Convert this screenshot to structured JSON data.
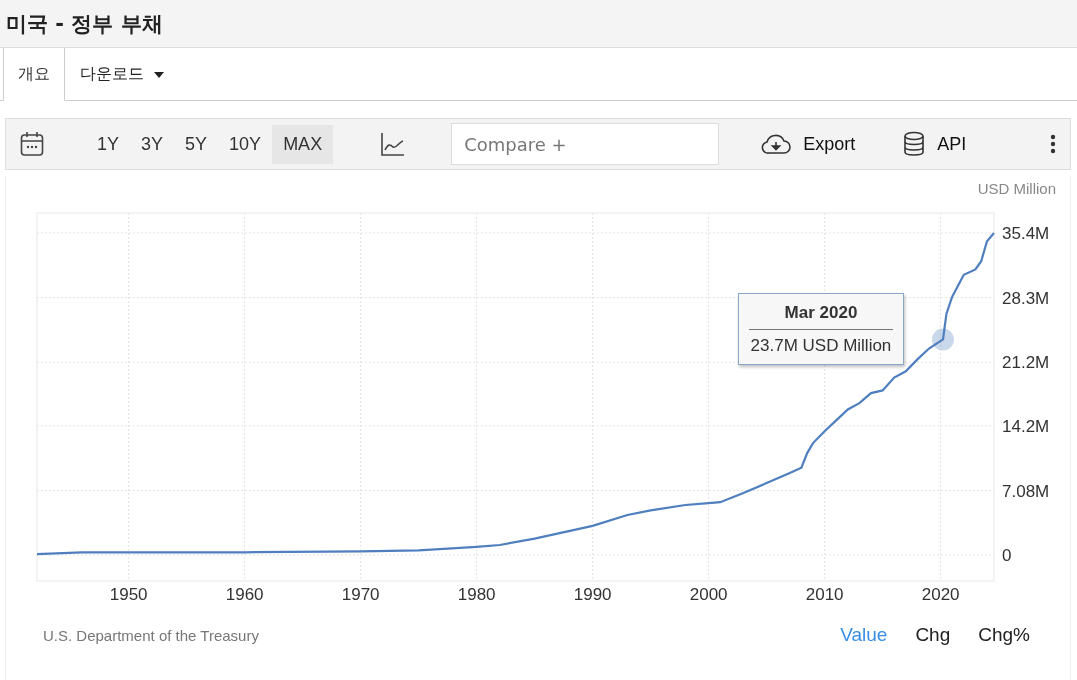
{
  "page": {
    "title": "미국 - 정부 부채"
  },
  "tabs": [
    {
      "label": "개요",
      "selected": true,
      "dropdown": false
    },
    {
      "label": "다운로드",
      "selected": false,
      "dropdown": true
    }
  ],
  "toolbar": {
    "ranges": [
      {
        "label": "1Y",
        "selected": false
      },
      {
        "label": "3Y",
        "selected": false
      },
      {
        "label": "5Y",
        "selected": false
      },
      {
        "label": "10Y",
        "selected": false
      },
      {
        "label": "MAX",
        "selected": true
      }
    ],
    "compare": {
      "placeholder": "Compare +"
    },
    "export": "Export",
    "api": "API"
  },
  "chart": {
    "unit": "USD Million",
    "chart_data": {
      "type": "line",
      "x": [
        1942.1,
        1946,
        1950,
        1960,
        1970,
        1975,
        1980,
        1982,
        1985,
        1990,
        1993,
        1995,
        1998,
        2000,
        2001,
        2003,
        2005,
        2007,
        2008,
        2008.5,
        2009,
        2010,
        2011,
        2012,
        2013,
        2014,
        2015,
        2016,
        2017,
        2018,
        2019,
        2020.2,
        2020.5,
        2021,
        2022,
        2023,
        2023.5,
        2024,
        2024.6
      ],
      "series": [
        {
          "color": "#4f7fbf",
          "values": [
            0.1,
            0.3,
            0.3,
            0.3,
            0.4,
            0.5,
            0.9,
            1.1,
            1.8,
            3.2,
            4.4,
            4.9,
            5.5,
            5.7,
            5.8,
            6.8,
            7.9,
            9.0,
            9.6,
            11.2,
            12.3,
            13.6,
            14.8,
            16.0,
            16.7,
            17.8,
            18.1,
            19.5,
            20.2,
            21.5,
            22.7,
            23.7,
            26.5,
            28.4,
            30.8,
            31.4,
            32.3,
            34.5,
            35.4
          ]
        }
      ],
      "grid": true,
      "xlim": [
        1942.1,
        2024.6
      ],
      "ylim": [
        -2.86,
        37.6
      ],
      "xticks": [
        1950,
        1960,
        1970,
        1980,
        1990,
        2000,
        2010,
        2020
      ],
      "yticks": [
        {
          "value": 0,
          "label": "0"
        },
        {
          "value": 7.08,
          "label": "7.08M"
        },
        {
          "value": 14.2,
          "label": "14.2M"
        },
        {
          "value": 21.2,
          "label": "21.2M"
        },
        {
          "value": 28.3,
          "label": "28.3M"
        },
        {
          "value": 35.4,
          "label": "35.4M"
        }
      ]
    },
    "tooltip": {
      "title": "Mar 2020",
      "text": "23.7M USD Million"
    }
  },
  "footer": {
    "source": "U.S. Department of the Treasury",
    "views": [
      {
        "label": "Value",
        "selected": true
      },
      {
        "label": "Chg",
        "selected": false
      },
      {
        "label": "Chg%",
        "selected": false
      }
    ]
  }
}
